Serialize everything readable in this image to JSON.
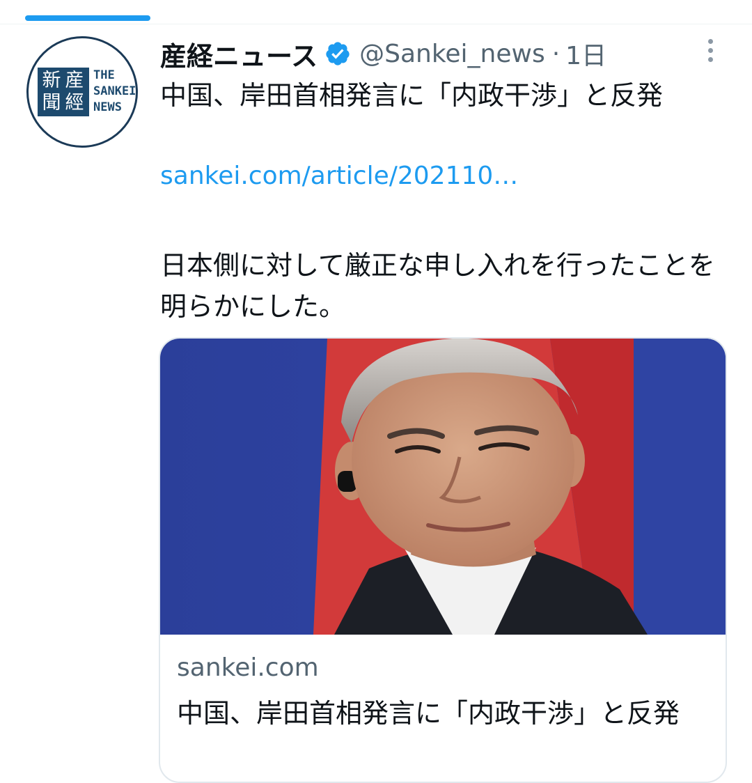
{
  "tweet": {
    "author_name": "産経ニュース",
    "handle": "@Sankei_news",
    "separator": "·",
    "time": "1日",
    "headline": "中国、岸田首相発言に「内政干渉」と反発",
    "link": "sankei.com/article/202110…",
    "body": "日本側に対して厳正な申し入れを行ったことを明らかにした。"
  },
  "avatar": {
    "seal_chars": [
      "産",
      "經",
      "新",
      "聞"
    ],
    "wordmark_lines": [
      "THE",
      "SANKEI",
      "NEWS"
    ]
  },
  "card": {
    "domain": "sankei.com",
    "title": "中国、岸田首相発言に「内政干渉」と反発"
  },
  "colors": {
    "accent": "#1d9bf0",
    "text": "#0f1419",
    "secondary": "#536471",
    "logo_blue": "#1d4a6e"
  }
}
